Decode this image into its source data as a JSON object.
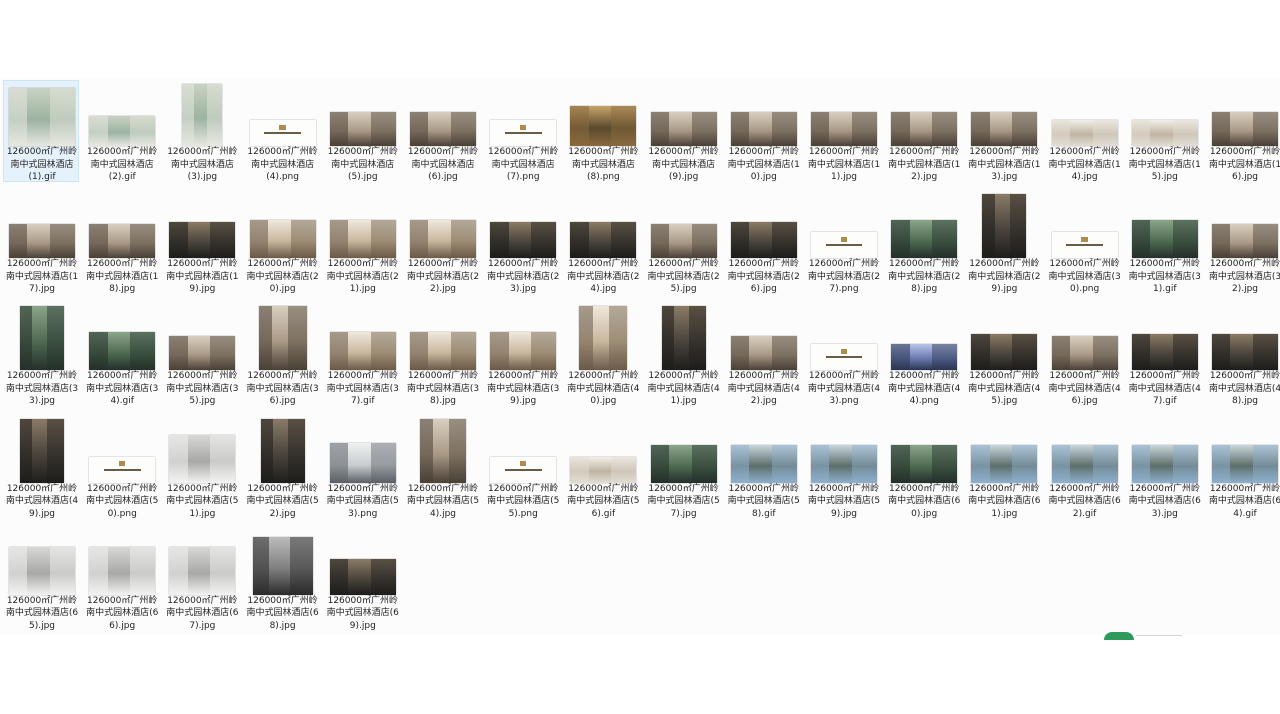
{
  "files": [
    {
      "name": "126000㎡广州岭南中式园林酒店(1).gif",
      "kind": "painting",
      "selected": true
    },
    {
      "name": "126000㎡广州岭南中式园林酒店(2).gif",
      "kind": "painting"
    },
    {
      "name": "126000㎡广州岭南中式园林酒店(3).jpg",
      "kind": "painting"
    },
    {
      "name": "126000㎡广州岭南中式园林酒店(4).png",
      "kind": "card"
    },
    {
      "name": "126000㎡广州岭南中式园林酒店(5).jpg",
      "kind": "lobby"
    },
    {
      "name": "126000㎡广州岭南中式园林酒店(6).jpg",
      "kind": "lobby"
    },
    {
      "name": "126000㎡广州岭南中式园林酒店(7).png",
      "kind": "card"
    },
    {
      "name": "126000㎡广州岭南中式园林酒店(8).png",
      "kind": "art"
    },
    {
      "name": "126000㎡广州岭南中式园林酒店(9).jpg",
      "kind": "lobby"
    },
    {
      "name": "126000㎡广州岭南中式园林酒店(10).jpg",
      "kind": "lobby"
    },
    {
      "name": "126000㎡广州岭南中式园林酒店(11).jpg",
      "kind": "lobby"
    },
    {
      "name": "126000㎡广州岭南中式园林酒店(12).jpg",
      "kind": "lobby"
    },
    {
      "name": "126000㎡广州岭南中式园林酒店(13).jpg",
      "kind": "lobby"
    },
    {
      "name": "126000㎡广州岭南中式园林酒店(14).jpg",
      "kind": "bright"
    },
    {
      "name": "126000㎡广州岭南中式园林酒店(15).jpg",
      "kind": "bright"
    },
    {
      "name": "126000㎡广州岭南中式园林酒店(16).jpg",
      "kind": "lobby"
    },
    {
      "name": "126000㎡广州岭南中式园林酒店(17).jpg",
      "kind": "lobby"
    },
    {
      "name": "126000㎡广州岭南中式园林酒店(18).jpg",
      "kind": "lobby"
    },
    {
      "name": "126000㎡广州岭南中式园林酒店(19).jpg",
      "kind": "dark"
    },
    {
      "name": "126000㎡广州岭南中式园林酒店(20).jpg",
      "kind": "room"
    },
    {
      "name": "126000㎡广州岭南中式园林酒店(21).jpg",
      "kind": "room"
    },
    {
      "name": "126000㎡广州岭南中式园林酒店(22).jpg",
      "kind": "room"
    },
    {
      "name": "126000㎡广州岭南中式园林酒店(23).jpg",
      "kind": "dark"
    },
    {
      "name": "126000㎡广州岭南中式园林酒店(24).jpg",
      "kind": "dark"
    },
    {
      "name": "126000㎡广州岭南中式园林酒店(25).jpg",
      "kind": "lobby"
    },
    {
      "name": "126000㎡广州岭南中式园林酒店(26).jpg",
      "kind": "dark"
    },
    {
      "name": "126000㎡广州岭南中式园林酒店(27).png",
      "kind": "card"
    },
    {
      "name": "126000㎡广州岭南中式园林酒店(28).jpg",
      "kind": "garden"
    },
    {
      "name": "126000㎡广州岭南中式园林酒店(29).jpg",
      "kind": "dark"
    },
    {
      "name": "126000㎡广州岭南中式园林酒店(30).png",
      "kind": "card"
    },
    {
      "name": "126000㎡广州岭南中式园林酒店(31).gif",
      "kind": "garden"
    },
    {
      "name": "126000㎡广州岭南中式园林酒店(32).jpg",
      "kind": "lobby"
    },
    {
      "name": "126000㎡广州岭南中式园林酒店(33).jpg",
      "kind": "garden"
    },
    {
      "name": "126000㎡广州岭南中式园林酒店(34).gif",
      "kind": "garden"
    },
    {
      "name": "126000㎡广州岭南中式园林酒店(35).jpg",
      "kind": "lobby"
    },
    {
      "name": "126000㎡广州岭南中式园林酒店(36).jpg",
      "kind": "lobby"
    },
    {
      "name": "126000㎡广州岭南中式园林酒店(37).gif",
      "kind": "room"
    },
    {
      "name": "126000㎡广州岭南中式园林酒店(38).jpg",
      "kind": "room"
    },
    {
      "name": "126000㎡广州岭南中式园林酒店(39).jpg",
      "kind": "room"
    },
    {
      "name": "126000㎡广州岭南中式园林酒店(40).jpg",
      "kind": "room"
    },
    {
      "name": "126000㎡广州岭南中式园林酒店(41).jpg",
      "kind": "dark"
    },
    {
      "name": "126000㎡广州岭南中式园林酒店(42).jpg",
      "kind": "lobby"
    },
    {
      "name": "126000㎡广州岭南中式园林酒店(43).png",
      "kind": "card"
    },
    {
      "name": "126000㎡广州岭南中式园林酒店(44).png",
      "kind": "blue"
    },
    {
      "name": "126000㎡广州岭南中式园林酒店(45).jpg",
      "kind": "dark"
    },
    {
      "name": "126000㎡广州岭南中式园林酒店(46).jpg",
      "kind": "lobby"
    },
    {
      "name": "126000㎡广州岭南中式园林酒店(47).gif",
      "kind": "dark"
    },
    {
      "name": "126000㎡广州岭南中式园林酒店(48).jpg",
      "kind": "dark"
    },
    {
      "name": "126000㎡广州岭南中式园林酒店(49).jpg",
      "kind": "dark"
    },
    {
      "name": "126000㎡广州岭南中式园林酒店(50).png",
      "kind": "card"
    },
    {
      "name": "126000㎡广州岭南中式园林酒店(51).jpg",
      "kind": "plan"
    },
    {
      "name": "126000㎡广州岭南中式园林酒店(52).jpg",
      "kind": "dark"
    },
    {
      "name": "126000㎡广州岭南中式园林酒店(53).png",
      "kind": "moodboard"
    },
    {
      "name": "126000㎡广州岭南中式园林酒店(54).jpg",
      "kind": "lobby"
    },
    {
      "name": "126000㎡广州岭南中式园林酒店(55).png",
      "kind": "card"
    },
    {
      "name": "126000㎡广州岭南中式园林酒店(56).gif",
      "kind": "bright"
    },
    {
      "name": "126000㎡广州岭南中式园林酒店(57).jpg",
      "kind": "garden"
    },
    {
      "name": "126000㎡广州岭南中式园林酒店(58).gif",
      "kind": "exterior"
    },
    {
      "name": "126000㎡广州岭南中式园林酒店(59).jpg",
      "kind": "exterior"
    },
    {
      "name": "126000㎡广州岭南中式园林酒店(60).jpg",
      "kind": "garden"
    },
    {
      "name": "126000㎡广州岭南中式园林酒店(61).jpg",
      "kind": "exterior"
    },
    {
      "name": "126000㎡广州岭南中式园林酒店(62).gif",
      "kind": "exterior"
    },
    {
      "name": "126000㎡广州岭南中式园林酒店(63).jpg",
      "kind": "exterior"
    },
    {
      "name": "126000㎡广州岭南中式园林酒店(64).gif",
      "kind": "exterior"
    },
    {
      "name": "126000㎡广州岭南中式园林酒店(65).jpg",
      "kind": "plan"
    },
    {
      "name": "126000㎡广州岭南中式园林酒店(66).jpg",
      "kind": "plan"
    },
    {
      "name": "126000㎡广州岭南中式园林酒店(67).jpg",
      "kind": "plan"
    },
    {
      "name": "126000㎡广州岭南中式园林酒店(68).jpg",
      "kind": "darkplan"
    },
    {
      "name": "126000㎡广州岭南中式园林酒店(69).jpg",
      "kind": "dark"
    }
  ],
  "palettes": {
    "painting": [
      "#e6e8e0",
      "#9db3a1",
      "#c9d2c2"
    ],
    "card": [
      "#fdfdfb",
      "#f4f2ec",
      "#ffffff"
    ],
    "lobby": [
      "#4a4036",
      "#a99a86",
      "#d9cfbf"
    ],
    "room": [
      "#6a5a48",
      "#c8b89e",
      "#efe8dc"
    ],
    "dark": [
      "#1e1d1b",
      "#4a443c",
      "#8a7b66"
    ],
    "bright": [
      "#e2ddd4",
      "#bfb4a2",
      "#f3efe8"
    ],
    "garden": [
      "#24302a",
      "#4f6b52",
      "#8aa58a"
    ],
    "exterior": [
      "#8fb0cf",
      "#5d6f6a",
      "#c9d6dd"
    ],
    "plan": [
      "#f3f3f1",
      "#a8a8a6",
      "#d8d8d6"
    ],
    "darkplan": [
      "#2b2b2b",
      "#7e7e7e",
      "#bcbcbc"
    ],
    "art": [
      "#8a6a3e",
      "#5a4a2e",
      "#c7a46a"
    ],
    "blue": [
      "#2a3550",
      "#6a7ab0",
      "#b8c4e8"
    ],
    "moodboard": [
      "#5a6066",
      "#c9cdcf",
      "#eef0f1"
    ]
  }
}
